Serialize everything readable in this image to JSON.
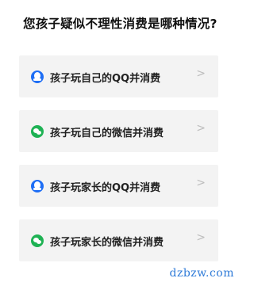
{
  "title": "您孩子疑似不理性消费是哪种情况?",
  "options": [
    {
      "icon": "qq-icon",
      "label": "孩子玩自己的QQ并消费",
      "chevron": ">"
    },
    {
      "icon": "wechat-icon",
      "label": "孩子玩自己的微信并消费",
      "chevron": ">"
    },
    {
      "icon": "qq-icon",
      "label": "孩子玩家长的QQ并消费",
      "chevron": ">"
    },
    {
      "icon": "wechat-icon",
      "label": "孩子玩家长的微信并消费",
      "chevron": ">"
    }
  ],
  "watermark": "dzbzw.com",
  "colors": {
    "qq_icon": "#1e6ef5",
    "wechat_icon": "#1fb254",
    "option_bg": "#f3f3f3",
    "chevron": "#bdbdbd",
    "watermark": "#2f7bd8"
  }
}
